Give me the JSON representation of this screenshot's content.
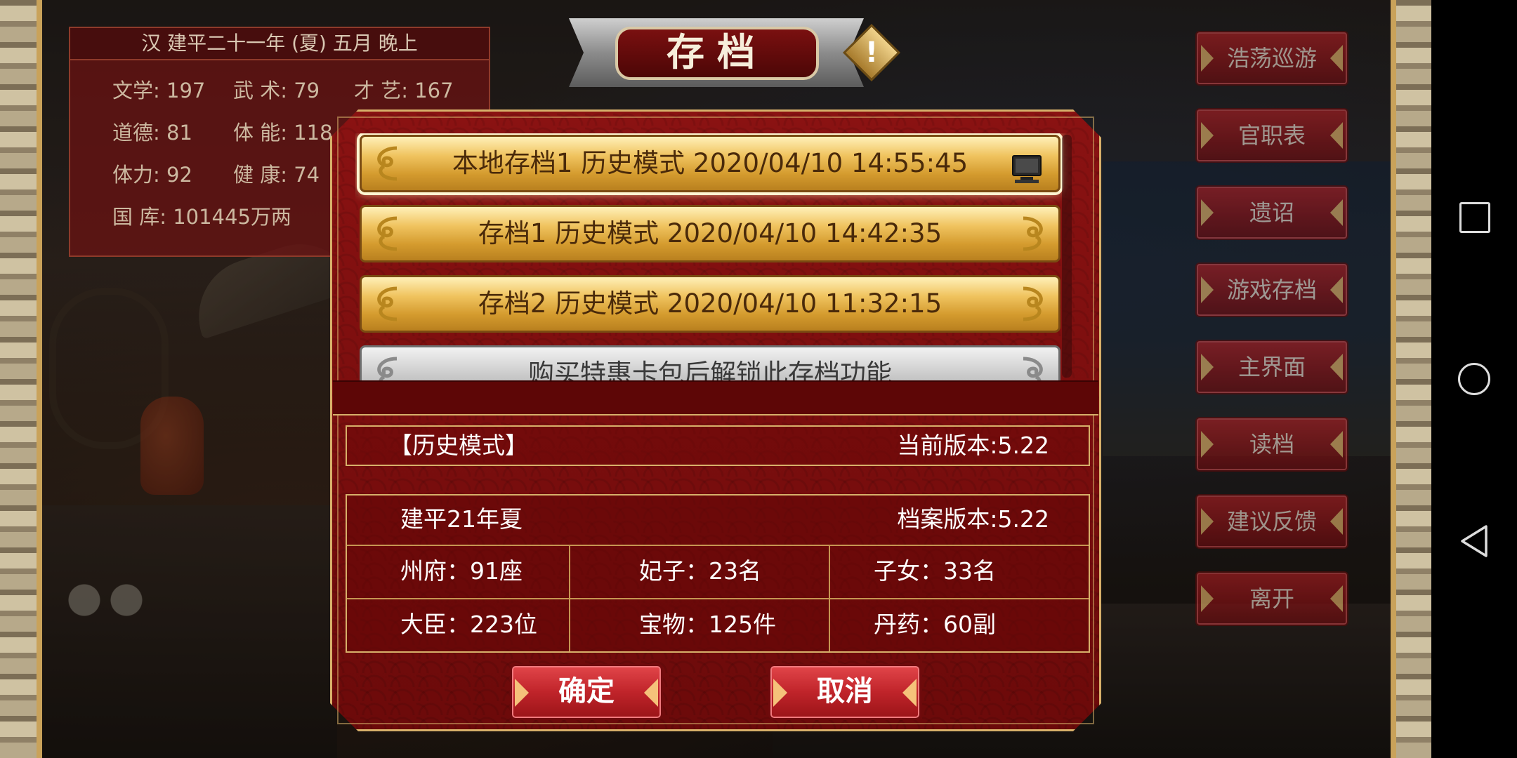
{
  "stats": {
    "title": "汉 建平二十一年 (夏) 五月 晚上",
    "literature": "文学: 197",
    "martial": "武 术: 79",
    "talent": "才 艺: 167",
    "morality": "道德: 81",
    "physique": "体 能: 118",
    "stamina": "体力: 92",
    "health": "健 康: 74",
    "treasury": "国 库: 101445万两"
  },
  "dialog": {
    "title": "存档",
    "saves": [
      {
        "label": "本地存档1   历史模式   2020/04/10 14:55:45",
        "state": "selected"
      },
      {
        "label": "存档1   历史模式   2020/04/10 14:42:35",
        "state": "normal"
      },
      {
        "label": "存档2   历史模式   2020/04/10 11:32:15",
        "state": "normal"
      },
      {
        "label": "购买特惠卡包后解锁此存档功能",
        "state": "locked"
      }
    ],
    "info": {
      "mode": "【历史模式】",
      "current_version": "当前版本:5.22",
      "period": "建平21年夏",
      "file_version": "档案版本:5.22",
      "prefectures": "州府：91座",
      "consorts": "妃子：23名",
      "children": "子女：33名",
      "ministers": "大臣：223位",
      "treasures": "宝物：125件",
      "elixirs": "丹药：60副"
    },
    "ok_label": "确定",
    "cancel_label": "取消"
  },
  "menu": [
    "浩荡巡游",
    "官职表",
    "遗诏",
    "游戏存档",
    "主界面",
    "读档",
    "建议反馈",
    "离开"
  ],
  "icons": {
    "warning": "warning-icon",
    "local_save": "computer-icon",
    "scroll": "scroll-ornament-icon"
  },
  "colors": {
    "dialog_red": "#8a1212",
    "gold_border": "#d7b06a",
    "save_gold": "#f0c460",
    "locked_gray": "#cfcfcf"
  }
}
